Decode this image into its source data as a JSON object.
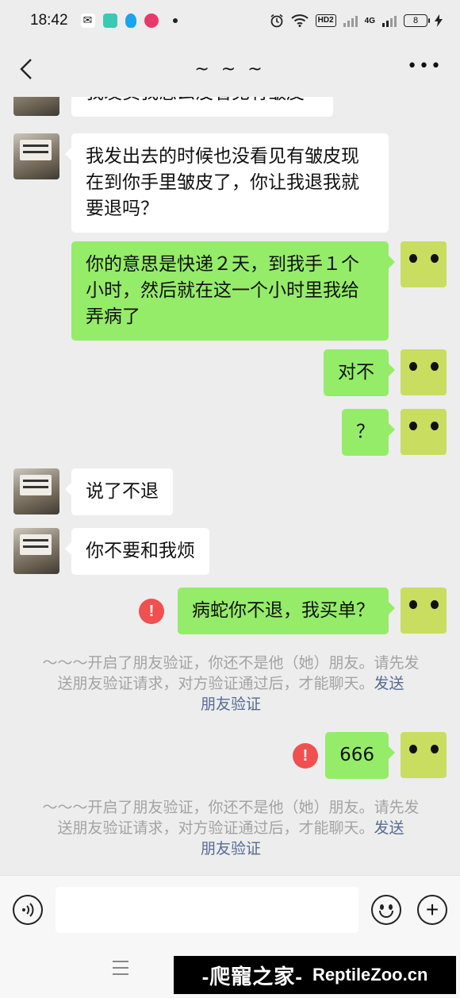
{
  "status": {
    "time": "18:42",
    "hd": "HD2",
    "net": "4G",
    "battery": "8"
  },
  "nav": {
    "title": "~ ~ ~"
  },
  "messages": [
    {
      "side": "other",
      "text": "我发货我怎么没看见有皱皮"
    },
    {
      "side": "other",
      "lines": [
        "我发出去的时候也没看见有皱皮现",
        "在到你手里皱皮了，你让我退我就",
        "要退吗？"
      ]
    },
    {
      "side": "me",
      "lines": [
        "你的意思是快递２天，到我手１个",
        "小时，然后就在这一个小时里我给",
        "弄病了"
      ]
    },
    {
      "side": "me",
      "text": "对不"
    },
    {
      "side": "me",
      "text": "？"
    },
    {
      "side": "other",
      "text": "说了不退"
    },
    {
      "side": "other",
      "text": "你不要和我烦"
    },
    {
      "side": "me",
      "text": "病蛇你不退，我买单？",
      "failed": true
    },
    {
      "side": "me",
      "text": "666",
      "failed": true
    }
  ],
  "system": {
    "line1": "～～～开启了朋友验证，你还不是他（她）朋友。请先",
    "line2": "发送朋友验证请求，对方验证通过后，才能聊天。",
    "link1": "发送",
    "link2": "朋友验证"
  },
  "watermark": {
    "cn": "-爬寵之家-",
    "en": "ReptileZoo.cn"
  },
  "colors": {
    "me_bubble": "#95ec69",
    "other_bubble": "#ffffff",
    "background": "#ededed",
    "link": "#566b94",
    "warn": "#f05050"
  }
}
